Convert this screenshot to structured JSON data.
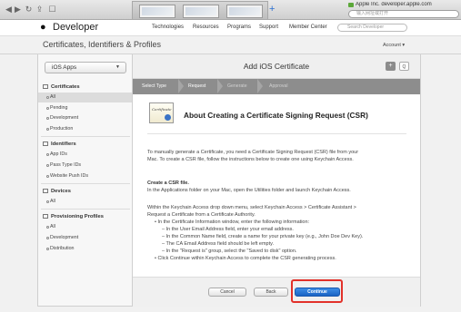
{
  "browser": {
    "tabs_count_label": "",
    "url": "Apple Inc. developer.apple.com",
    "search_placeholder": "输入网址或打开",
    "new_tab_symbol": "+"
  },
  "site": {
    "logo_icon": "apple-logo",
    "title": "Developer",
    "nav": [
      "Technologies",
      "Resources",
      "Programs",
      "Support",
      "Member Center"
    ],
    "search_placeholder": "Search Developer"
  },
  "subheader": {
    "title": "Certificates, Identifiers & Profiles",
    "account_label": "Account ▾"
  },
  "sidebar": {
    "platform": "iOS Apps",
    "sections": [
      {
        "title": "Certificates",
        "items": [
          "All",
          "Pending",
          "Development",
          "Production"
        ]
      },
      {
        "title": "Identifiers",
        "items": [
          "App IDs",
          "Pass Type IDs",
          "Website Push IDs"
        ]
      },
      {
        "title": "Devices",
        "items": [
          "All"
        ]
      },
      {
        "title": "Provisioning Profiles",
        "items": [
          "All",
          "Development",
          "Distribution"
        ]
      }
    ],
    "active_item": "All"
  },
  "main": {
    "title": "Add iOS Certificate",
    "add_symbol": "+",
    "search_symbol": "Q",
    "steps": [
      "Select Type",
      "Request",
      "Generate",
      "Approval"
    ],
    "active_step": "Request",
    "cert_icon_text": "Certificate",
    "about_title": "About Creating a Certificate Signing Request (CSR)",
    "intro_lines": [
      "To manually generate a Certificate, you need a Certificate Signing Request (CSR) file from your",
      "Mac. To create a CSR file, follow the instructions below to create one using Keychain Access."
    ],
    "create_heading": "Create a CSR file.",
    "create_line": "In the Applications folder on your Mac, open the Utilities folder and launch Keychain Access.",
    "within_lines": [
      "Within the Keychain Access drop down menu, select Keychain Access > Certificate Assistant >",
      "Request a Certificate from a Certificate Authority."
    ],
    "bullets": [
      "• In the Certificate Information window, enter the following information:",
      "– In the User Email Address field, enter your email address.",
      "– In the Common Name field, create a name for your private key (e.g., John Doe Dev Key).",
      "– The CA Email Address field should be left empty.",
      "– In the \"Request is\" group, select the \"Saved to disk\" option.",
      "• Click Continue within Keychain Access to complete the CSR generating process."
    ],
    "buttons": {
      "cancel": "Cancel",
      "back": "Back",
      "continue": "Continue"
    }
  },
  "colors": {
    "highlight": "#e2312a",
    "primary_button": "#1a63c4",
    "steps_bar": "#8d8d8d"
  }
}
